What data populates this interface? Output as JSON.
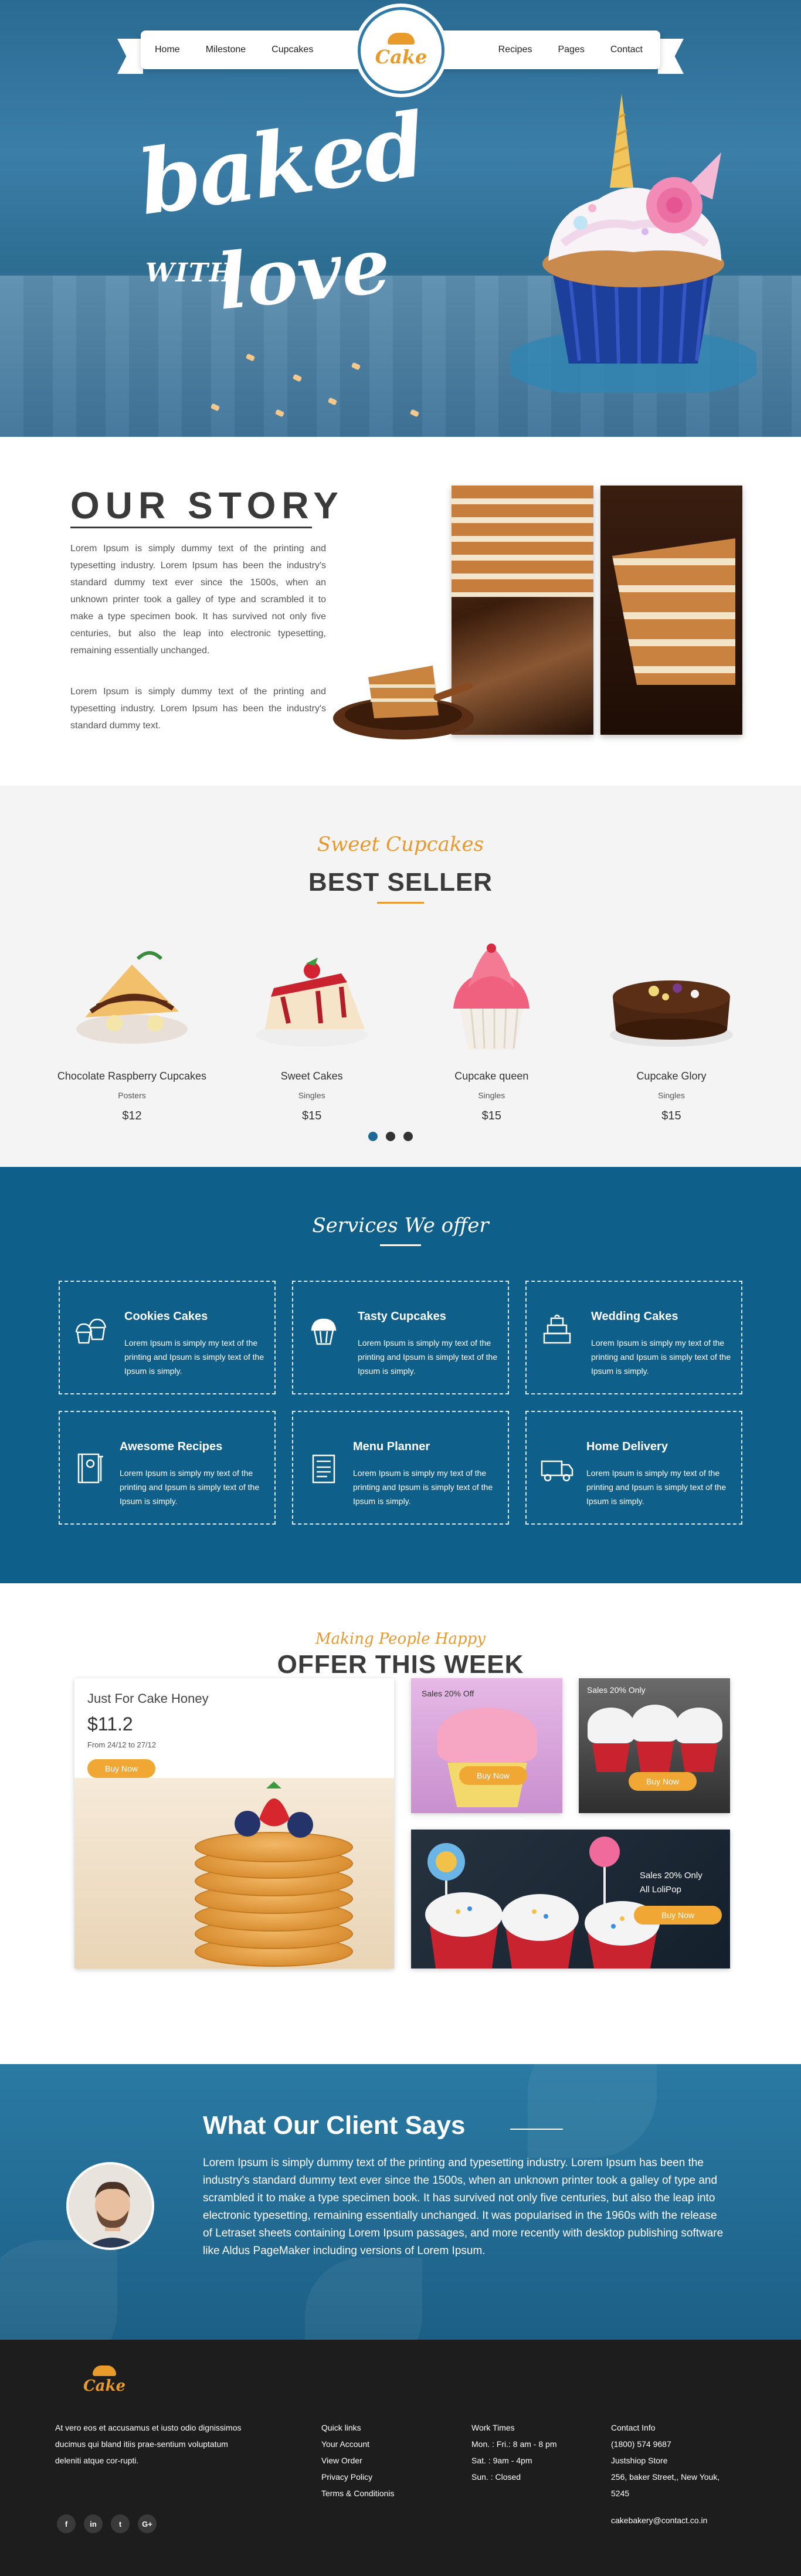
{
  "nav": {
    "left": [
      "Home",
      "Milestone",
      "Cupcakes"
    ],
    "right": [
      "Recipes",
      "Pages",
      "Contact"
    ],
    "logo_text": "Cake"
  },
  "hero": {
    "line1": "baked",
    "line2": "WITH",
    "line3": "love"
  },
  "story": {
    "title": "OUR STORY",
    "paragraph1": "Lorem Ipsum is simply dummy text of the printing and typesetting industry. Lorem Ipsum has been the industry's standard dummy text ever since the 1500s, when an unknown printer took a galley of type and scrambled it to make a type specimen book. It has survived not only five centuries, but also the leap into electronic typesetting, remaining essentially unchanged.",
    "paragraph2": "Lorem Ipsum is simply dummy text of the printing and typesetting industry. Lorem Ipsum has been the industry's standard dummy text."
  },
  "bestseller": {
    "script": "Sweet Cupcakes",
    "title": "BEST SELLER",
    "products": [
      {
        "name": "Chocolate Raspberry Cupcakes",
        "category": "Posters",
        "price": "$12"
      },
      {
        "name": "Sweet Cakes",
        "category": "Singles",
        "price": "$15"
      },
      {
        "name": "Cupcake queen",
        "category": "Singles",
        "price": "$15"
      },
      {
        "name": "Cupcake Glory",
        "category": "Singles",
        "price": "$15"
      }
    ]
  },
  "services": {
    "script": "Services We offer",
    "items": [
      {
        "title": "Cookies Cakes",
        "desc": "Lorem Ipsum is simply my text of the printing and Ipsum is simply text of the Ipsum is simply.",
        "icon": "cupcakes-icon"
      },
      {
        "title": "Tasty Cupcakes",
        "desc": "Lorem Ipsum is simply my text of the printing and Ipsum is simply text of the Ipsum is simply.",
        "icon": "cupcake-icon"
      },
      {
        "title": "Wedding Cakes",
        "desc": "Lorem Ipsum is simply my text of the printing and Ipsum is simply text of the Ipsum is simply.",
        "icon": "wedding-cake-icon"
      },
      {
        "title": "Awesome Recipes",
        "desc": "Lorem Ipsum is simply my text of the printing and Ipsum is simply text of the Ipsum is simply.",
        "icon": "recipe-book-icon"
      },
      {
        "title": "Menu Planner",
        "desc": "Lorem Ipsum is simply my text of the printing and Ipsum is simply text of the Ipsum is simply.",
        "icon": "menu-board-icon"
      },
      {
        "title": "Home Delivery",
        "desc": "Lorem Ipsum is simply my text of the printing and Ipsum is simply text of the Ipsum is simply.",
        "icon": "delivery-truck-icon"
      }
    ]
  },
  "offers": {
    "script": "Making People Happy",
    "title": "OFFER THIS WEEK",
    "main": {
      "title": "Just For Cake Honey",
      "price": "$11.2",
      "dates": "From 24/12 to 27/12",
      "button": "Buy Now"
    },
    "card_a": {
      "label": "Sales 20% Off",
      "button": "Buy Now"
    },
    "card_b": {
      "label": "Sales 20% Only",
      "button": "Buy Now"
    },
    "card_c": {
      "label1": "Sales 20% Only",
      "label2": "All LoliPop",
      "button": "Buy Now"
    }
  },
  "testimonial": {
    "title": "What Our Client Says",
    "text": "Lorem Ipsum is simply dummy text of the printing and typesetting industry. Lorem Ipsum has been the industry's standard dummy text ever since the 1500s, when an unknown printer took a galley of type and scrambled it to make a type specimen book. It has survived not only five centuries, but also the leap into electronic typesetting, remaining essentially unchanged. It was popularised in the 1960s with the release of Letraset sheets containing Lorem Ipsum passages, and more recently with desktop publishing software like Aldus PageMaker including versions of Lorem Ipsum."
  },
  "footer": {
    "logo_text": "Cake",
    "about": "At vero eos et accusamus et iusto odio dignissimos ducimus qui bland itiis prae-sentium voluptatum deleniti atque cor-rupti.",
    "quick_links": [
      "Quick links",
      "Your Account",
      "View Order",
      "Privacy Policy",
      "Terms & Conditionis"
    ],
    "work_times": [
      "Work Times",
      "Mon. : Fri.: 8 am - 8 pm",
      "Sat. : 9am - 4pm",
      "Sun. : Closed"
    ],
    "contact": [
      "Contact Info",
      "(1800) 574 9687",
      "Justshiop Store",
      "256, baker Street,, New Youk,",
      "5245"
    ],
    "social": [
      "f",
      "in",
      "t",
      "G+"
    ],
    "email": "cakebakery@contact.co.in"
  }
}
